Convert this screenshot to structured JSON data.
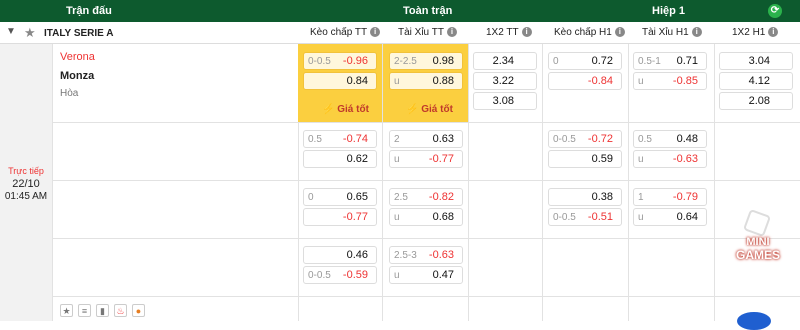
{
  "header": {
    "match_col": "Trận đấu",
    "fulltime": "Toàn trận",
    "half": "Hiệp 1",
    "refresh_icon": "refresh-icon"
  },
  "league": {
    "name": "ITALY SERIE A"
  },
  "columns": {
    "handicap_ft": "Kèo chấp TT",
    "ou_ft": "Tài Xỉu TT",
    "x12_ft": "1X2 TT",
    "handicap_h1": "Kèo chấp H1",
    "ou_h1": "Tài Xỉu H1",
    "x12_h1": "1X2 H1"
  },
  "match": {
    "status": "Trực tiếp",
    "date": "22/10",
    "time": "01:45 AM",
    "home": "Verona",
    "away": "Monza",
    "draw": "Hòa"
  },
  "best_label": "Giá tốt",
  "rows": [
    {
      "hdp_ft": [
        [
          "0-0.5",
          "-0.96"
        ],
        [
          "",
          "0.84"
        ]
      ],
      "ou_ft": [
        [
          "2-2.5",
          "0.98"
        ],
        [
          "u",
          "0.88"
        ]
      ],
      "x12_ft": [
        "2.34",
        "3.22",
        "3.08"
      ],
      "hdp_h1": [
        [
          "0",
          "0.72"
        ],
        [
          "",
          "-0.84"
        ]
      ],
      "ou_h1": [
        [
          "0.5-1",
          "0.71"
        ],
        [
          "u",
          "-0.85"
        ]
      ],
      "x12_h1": [
        "3.04",
        "4.12",
        "2.08"
      ]
    },
    {
      "hdp_ft": [
        [
          "0.5",
          "-0.74"
        ],
        [
          "",
          "0.62"
        ]
      ],
      "ou_ft": [
        [
          "2",
          "0.63"
        ],
        [
          "u",
          "-0.77"
        ]
      ],
      "hdp_h1": [
        [
          "0-0.5",
          "-0.72"
        ],
        [
          "",
          "0.59"
        ]
      ],
      "ou_h1": [
        [
          "0.5",
          "0.48"
        ],
        [
          "u",
          "-0.63"
        ]
      ]
    },
    {
      "hdp_ft": [
        [
          "0",
          "0.65"
        ],
        [
          "",
          "-0.77"
        ]
      ],
      "ou_ft": [
        [
          "2.5",
          "-0.82"
        ],
        [
          "u",
          "0.68"
        ]
      ],
      "hdp_h1": [
        [
          "",
          "0.38"
        ],
        [
          "0-0.5",
          "-0.51"
        ]
      ],
      "ou_h1": [
        [
          "1",
          "-0.79"
        ],
        [
          "u",
          "0.64"
        ]
      ]
    },
    {
      "hdp_ft": [
        [
          "",
          "0.46"
        ],
        [
          "0-0.5",
          "-0.59"
        ]
      ],
      "ou_ft": [
        [
          "2.5-3",
          "-0.63"
        ],
        [
          "u",
          "0.47"
        ]
      ]
    }
  ],
  "bottom_icons": [
    "star-icon",
    "database-icon",
    "stats-icon",
    "fire-icon",
    "coin-icon"
  ],
  "minigames": {
    "line1": "MINI",
    "line2": "GAMES"
  }
}
